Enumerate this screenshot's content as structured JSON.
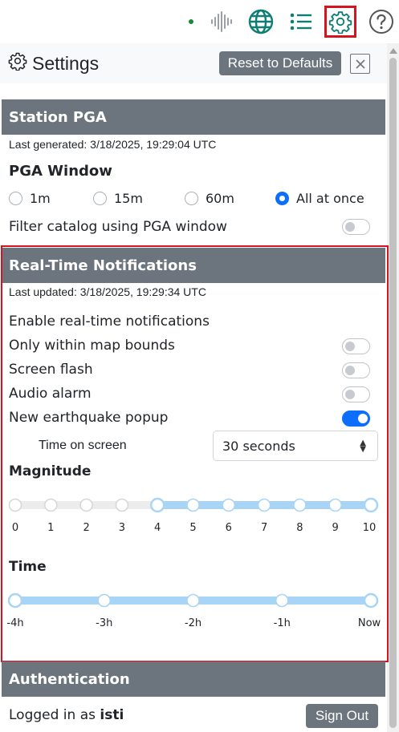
{
  "toolbar": {
    "icons": [
      "status-dot-icon",
      "waveform-icon",
      "globe-icon",
      "list-icon",
      "gear-icon",
      "help-icon"
    ],
    "active_icon": "gear-icon"
  },
  "settings": {
    "title": "Settings",
    "reset_label": "Reset to Defaults"
  },
  "station_pga": {
    "header": "Station PGA",
    "last_generated": "Last generated: 3/18/2025, 19:29:04 UTC",
    "window_label": "PGA Window",
    "options": [
      "1m",
      "15m",
      "60m",
      "All at once"
    ],
    "selected": "All at once",
    "filter_label": "Filter catalog using PGA window",
    "filter_enabled": false
  },
  "notifications": {
    "header": "Real-Time Notifications",
    "last_updated": "Last updated: 3/18/2025, 19:29:34 UTC",
    "enable_label": "Enable real-time notifications",
    "toggles": [
      {
        "label": "Only within map bounds",
        "on": false
      },
      {
        "label": "Screen flash",
        "on": false
      },
      {
        "label": "Audio alarm",
        "on": false
      },
      {
        "label": "New earthquake popup",
        "on": true
      }
    ],
    "time_on_screen_label": "Time on screen",
    "time_on_screen_value": "30 seconds",
    "magnitude": {
      "label": "Magnitude",
      "ticks": [
        "0",
        "1",
        "2",
        "3",
        "4",
        "5",
        "6",
        "7",
        "8",
        "9",
        "10"
      ],
      "range": [
        4,
        10
      ]
    },
    "time": {
      "label": "Time",
      "ticks": [
        "-4h",
        "-3h",
        "-2h",
        "-1h",
        "Now"
      ],
      "range": [
        "-4h",
        "Now"
      ]
    }
  },
  "authentication": {
    "header": "Authentication",
    "logged_in_prefix": "Logged in as ",
    "username": "isti",
    "sign_out_label": "Sign Out"
  },
  "colors": {
    "accent": "#0d6efd",
    "highlight_border": "#d6141f",
    "header_bg": "#6c757d",
    "slider_fill": "#a8d4f5",
    "icon_teal": "#0e7d74"
  }
}
